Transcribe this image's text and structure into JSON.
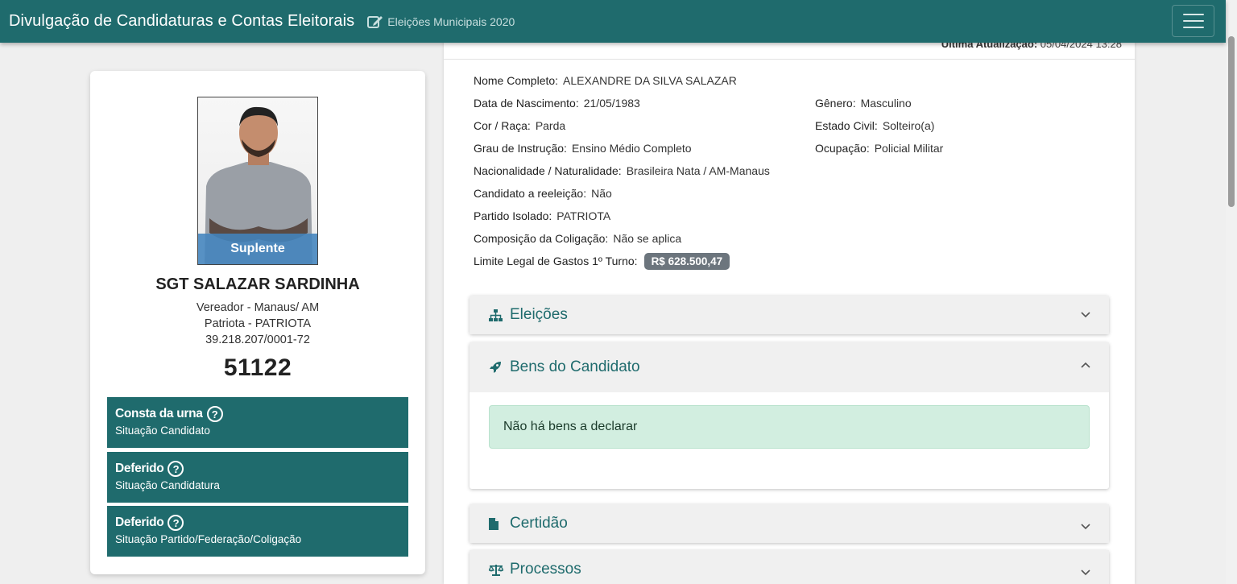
{
  "header": {
    "title": "Divulgação de Candidaturas e Contas Eleitorais",
    "subtitle": "Eleições Municipais 2020",
    "colors": {
      "primary": "#1f6b6d"
    }
  },
  "profile": {
    "photo_badge": "Suplente",
    "name": "SGT SALAZAR SARDINHA",
    "office": "Vereador - Manaus/ AM",
    "party": "Patriota - PATRIOTA",
    "cnpj": "39.218.207/0001-72",
    "number": "51122",
    "statuses": [
      {
        "title": "Consta da urna",
        "subtitle": "Situação Candidato"
      },
      {
        "title": "Deferido",
        "subtitle": "Situação Candidatura"
      },
      {
        "title": "Deferido",
        "subtitle": "Situação Partido/Federação/Coligação"
      }
    ]
  },
  "details": {
    "last_update_label": "Última Atualização:",
    "last_update_value": "05/04/2024 13:28",
    "nome_completo": {
      "label": "Nome Completo:",
      "value": "ALEXANDRE DA SILVA SALAZAR"
    },
    "nascimento": {
      "label": "Data de Nascimento:",
      "value": "21/05/1983"
    },
    "genero": {
      "label": "Gênero:",
      "value": "Masculino"
    },
    "cor_raca": {
      "label": "Cor / Raça:",
      "value": "Parda"
    },
    "estado_civil": {
      "label": "Estado Civil:",
      "value": "Solteiro(a)"
    },
    "instrucao": {
      "label": "Grau de Instrução:",
      "value": "Ensino Médio Completo"
    },
    "ocupacao": {
      "label": "Ocupação:",
      "value": "Policial Militar"
    },
    "nacionalidade": {
      "label": "Nacionalidade / Naturalidade:",
      "value": "Brasileira Nata / AM-Manaus"
    },
    "reeleicao": {
      "label": "Candidato a reeleição:",
      "value": "Não"
    },
    "partido": {
      "label": "Partido Isolado:",
      "value": "PATRIOTA"
    },
    "coligacao": {
      "label": "Composição da Coligação:",
      "value": "Não se aplica"
    },
    "limite": {
      "label": "Limite Legal de Gastos 1º Turno:",
      "value": "R$ 628.500,47"
    }
  },
  "accordions": {
    "eleicoes": {
      "label": "Eleições",
      "icon": "sitemap-icon"
    },
    "bens": {
      "label": "Bens do Candidato",
      "icon": "rocket-icon",
      "message": "Não há bens a declarar"
    },
    "certidao": {
      "label": "Certidão",
      "icon": "file-icon"
    },
    "processos": {
      "label": "Processos",
      "icon": "balance-scale-icon"
    }
  }
}
